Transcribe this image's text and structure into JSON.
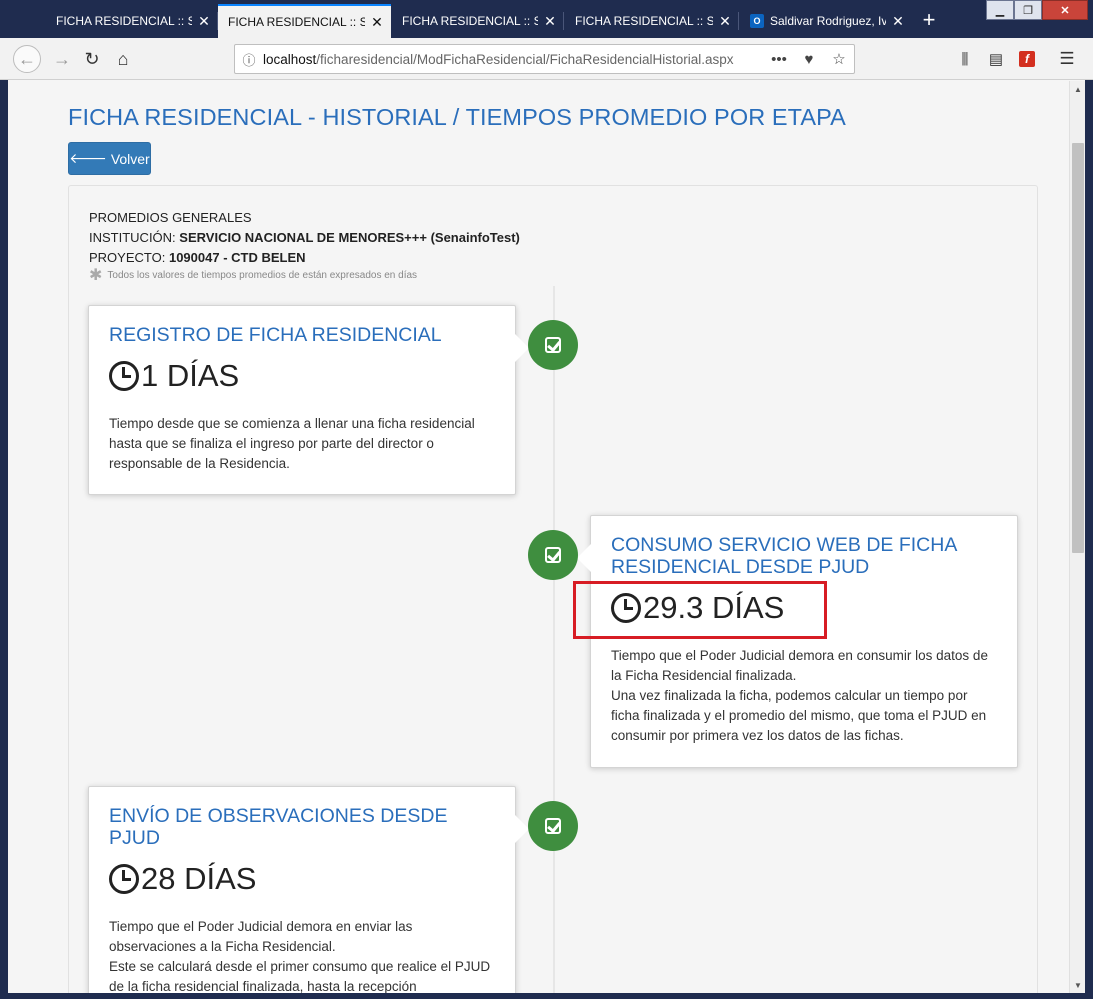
{
  "browser": {
    "tabs": [
      {
        "title": "FICHA RESIDENCIAL :: Ser",
        "active": false
      },
      {
        "title": "FICHA RESIDENCIAL :: Ser",
        "active": true
      },
      {
        "title": "FICHA RESIDENCIAL :: Ser",
        "active": false
      },
      {
        "title": "FICHA RESIDENCIAL :: Ser",
        "active": false
      },
      {
        "title": "Saldivar Rodriguez, Iv",
        "active": false
      }
    ],
    "url_host": "localhost",
    "url_path": "/ficharesidencial/ModFichaResidencial/FichaResidencialHistorial.aspx",
    "url_more": "•••",
    "icons": {
      "back": "back-arrow-icon",
      "forward": "forward-arrow-icon",
      "reload": "reload-icon",
      "home": "home-icon",
      "library": "library-icon",
      "sidebar": "sidebar-icon",
      "flash": "flash-icon",
      "menu": "hamburger-menu-icon"
    }
  },
  "page": {
    "title": "FICHA RESIDENCIAL - HISTORIAL / TIEMPOS PROMEDIO POR ETAPA",
    "back_button": "Volver",
    "summary": {
      "heading": "PROMEDIOS GENERALES",
      "institution_label": "INSTITUCIÓN:",
      "institution_value": "SERVICIO NACIONAL DE MENORES+++ (SenainfoTest)",
      "project_label": "PROYECTO:",
      "project_value": "1090047 - CTD BELEN",
      "note": "Todos los valores de tiempos promedios de están expresados en días"
    },
    "stages": [
      {
        "title": "REGISTRO DE FICHA RESIDENCIAL",
        "value": "1 DÍAS",
        "description": "Tiempo desde que se comienza a llenar una ficha residencial hasta que se finaliza el ingreso por parte del director o responsable de la Residencia."
      },
      {
        "title": "CONSUMO SERVICIO WEB DE FICHA RESIDENCIAL DESDE PJUD",
        "value": "29.3 DÍAS",
        "description_1": "Tiempo que el Poder Judicial demora en consumir los datos de la Ficha Residencial finalizada.",
        "description_2": "Una vez finalizada la ficha, podemos calcular un tiempo por ficha finalizada y el promedio del mismo, que toma el PJUD en consumir por primera vez los datos de las fichas."
      },
      {
        "title": "ENVÍO DE OBSERVACIONES DESDE PJUD",
        "value": "28 DÍAS",
        "description_1": "Tiempo que el Poder Judicial demora en enviar las observaciones a la Ficha Residencial.",
        "description_2": "Este se calculará desde el primer consumo que realice el PJUD de la ficha residencial finalizada, hasta la recepción"
      }
    ]
  }
}
